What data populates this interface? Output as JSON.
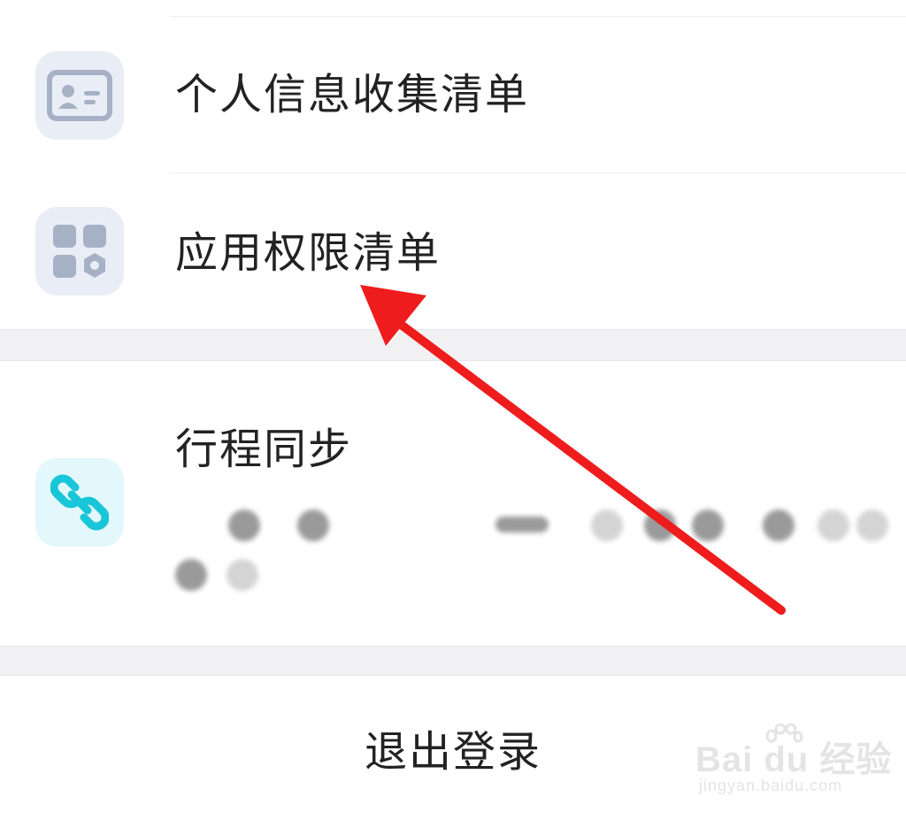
{
  "menu": {
    "items": [
      {
        "label": "个人信息收集清单",
        "icon": "id-card-icon"
      },
      {
        "label": "应用权限清单",
        "icon": "apps-grid-icon"
      }
    ]
  },
  "sync": {
    "label": "行程同步",
    "icon": "link-icon"
  },
  "logout": {
    "label": "退出登录"
  },
  "watermark": {
    "brand": "Bai du 经验",
    "url": "jingyan.baidu.com"
  },
  "colors": {
    "arrow": "#ee1c1c",
    "icon_tile_grey": "#e9edf6",
    "icon_tile_cyan": "#e3f8fc",
    "link_icon": "#19c5d8",
    "grey_icon": "#a7b1c6"
  }
}
